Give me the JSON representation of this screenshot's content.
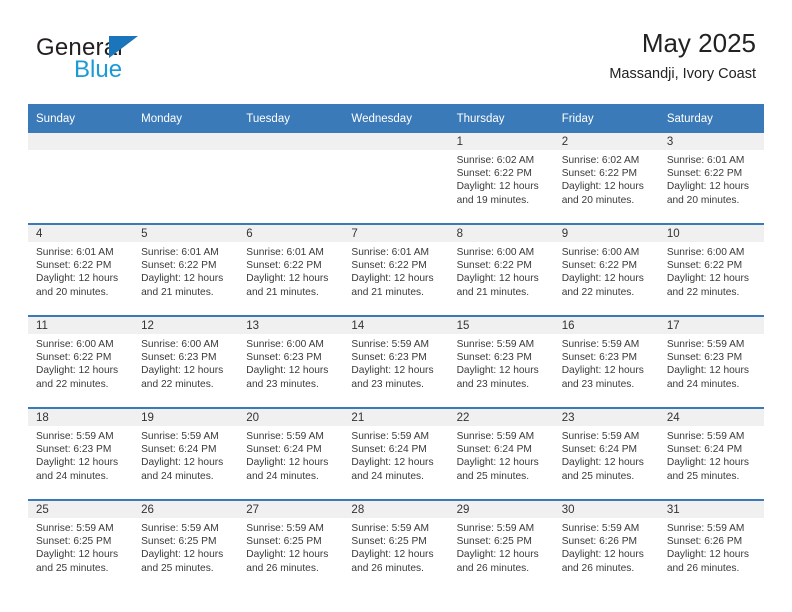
{
  "logo": {
    "word1": "General",
    "word2": "Blue",
    "triangle_color": "#1b75bb",
    "word2_color": "#1b9ad6"
  },
  "header": {
    "title": "May 2025",
    "subtitle": "Massandji, Ivory Coast"
  },
  "colors": {
    "header_blue": "#3b7ab8",
    "band_gray": "#f0f0f0",
    "text": "#222222"
  },
  "weekday_headers": [
    "Sunday",
    "Monday",
    "Tuesday",
    "Wednesday",
    "Thursday",
    "Friday",
    "Saturday"
  ],
  "labels": {
    "sunrise_prefix": "Sunrise:",
    "sunset_prefix": "Sunset:",
    "daylight_prefix": "Daylight:"
  },
  "weeks": [
    [
      {
        "day": "",
        "empty": true
      },
      {
        "day": "",
        "empty": true
      },
      {
        "day": "",
        "empty": true
      },
      {
        "day": "",
        "empty": true
      },
      {
        "day": "1",
        "sunrise": "Sunrise: 6:02 AM",
        "sunset": "Sunset: 6:22 PM",
        "daylight1": "Daylight: 12 hours",
        "daylight2": "and 19 minutes."
      },
      {
        "day": "2",
        "sunrise": "Sunrise: 6:02 AM",
        "sunset": "Sunset: 6:22 PM",
        "daylight1": "Daylight: 12 hours",
        "daylight2": "and 20 minutes."
      },
      {
        "day": "3",
        "sunrise": "Sunrise: 6:01 AM",
        "sunset": "Sunset: 6:22 PM",
        "daylight1": "Daylight: 12 hours",
        "daylight2": "and 20 minutes."
      }
    ],
    [
      {
        "day": "4",
        "sunrise": "Sunrise: 6:01 AM",
        "sunset": "Sunset: 6:22 PM",
        "daylight1": "Daylight: 12 hours",
        "daylight2": "and 20 minutes."
      },
      {
        "day": "5",
        "sunrise": "Sunrise: 6:01 AM",
        "sunset": "Sunset: 6:22 PM",
        "daylight1": "Daylight: 12 hours",
        "daylight2": "and 21 minutes."
      },
      {
        "day": "6",
        "sunrise": "Sunrise: 6:01 AM",
        "sunset": "Sunset: 6:22 PM",
        "daylight1": "Daylight: 12 hours",
        "daylight2": "and 21 minutes."
      },
      {
        "day": "7",
        "sunrise": "Sunrise: 6:01 AM",
        "sunset": "Sunset: 6:22 PM",
        "daylight1": "Daylight: 12 hours",
        "daylight2": "and 21 minutes."
      },
      {
        "day": "8",
        "sunrise": "Sunrise: 6:00 AM",
        "sunset": "Sunset: 6:22 PM",
        "daylight1": "Daylight: 12 hours",
        "daylight2": "and 21 minutes."
      },
      {
        "day": "9",
        "sunrise": "Sunrise: 6:00 AM",
        "sunset": "Sunset: 6:22 PM",
        "daylight1": "Daylight: 12 hours",
        "daylight2": "and 22 minutes."
      },
      {
        "day": "10",
        "sunrise": "Sunrise: 6:00 AM",
        "sunset": "Sunset: 6:22 PM",
        "daylight1": "Daylight: 12 hours",
        "daylight2": "and 22 minutes."
      }
    ],
    [
      {
        "day": "11",
        "sunrise": "Sunrise: 6:00 AM",
        "sunset": "Sunset: 6:22 PM",
        "daylight1": "Daylight: 12 hours",
        "daylight2": "and 22 minutes."
      },
      {
        "day": "12",
        "sunrise": "Sunrise: 6:00 AM",
        "sunset": "Sunset: 6:23 PM",
        "daylight1": "Daylight: 12 hours",
        "daylight2": "and 22 minutes."
      },
      {
        "day": "13",
        "sunrise": "Sunrise: 6:00 AM",
        "sunset": "Sunset: 6:23 PM",
        "daylight1": "Daylight: 12 hours",
        "daylight2": "and 23 minutes."
      },
      {
        "day": "14",
        "sunrise": "Sunrise: 5:59 AM",
        "sunset": "Sunset: 6:23 PM",
        "daylight1": "Daylight: 12 hours",
        "daylight2": "and 23 minutes."
      },
      {
        "day": "15",
        "sunrise": "Sunrise: 5:59 AM",
        "sunset": "Sunset: 6:23 PM",
        "daylight1": "Daylight: 12 hours",
        "daylight2": "and 23 minutes."
      },
      {
        "day": "16",
        "sunrise": "Sunrise: 5:59 AM",
        "sunset": "Sunset: 6:23 PM",
        "daylight1": "Daylight: 12 hours",
        "daylight2": "and 23 minutes."
      },
      {
        "day": "17",
        "sunrise": "Sunrise: 5:59 AM",
        "sunset": "Sunset: 6:23 PM",
        "daylight1": "Daylight: 12 hours",
        "daylight2": "and 24 minutes."
      }
    ],
    [
      {
        "day": "18",
        "sunrise": "Sunrise: 5:59 AM",
        "sunset": "Sunset: 6:23 PM",
        "daylight1": "Daylight: 12 hours",
        "daylight2": "and 24 minutes."
      },
      {
        "day": "19",
        "sunrise": "Sunrise: 5:59 AM",
        "sunset": "Sunset: 6:24 PM",
        "daylight1": "Daylight: 12 hours",
        "daylight2": "and 24 minutes."
      },
      {
        "day": "20",
        "sunrise": "Sunrise: 5:59 AM",
        "sunset": "Sunset: 6:24 PM",
        "daylight1": "Daylight: 12 hours",
        "daylight2": "and 24 minutes."
      },
      {
        "day": "21",
        "sunrise": "Sunrise: 5:59 AM",
        "sunset": "Sunset: 6:24 PM",
        "daylight1": "Daylight: 12 hours",
        "daylight2": "and 24 minutes."
      },
      {
        "day": "22",
        "sunrise": "Sunrise: 5:59 AM",
        "sunset": "Sunset: 6:24 PM",
        "daylight1": "Daylight: 12 hours",
        "daylight2": "and 25 minutes."
      },
      {
        "day": "23",
        "sunrise": "Sunrise: 5:59 AM",
        "sunset": "Sunset: 6:24 PM",
        "daylight1": "Daylight: 12 hours",
        "daylight2": "and 25 minutes."
      },
      {
        "day": "24",
        "sunrise": "Sunrise: 5:59 AM",
        "sunset": "Sunset: 6:24 PM",
        "daylight1": "Daylight: 12 hours",
        "daylight2": "and 25 minutes."
      }
    ],
    [
      {
        "day": "25",
        "sunrise": "Sunrise: 5:59 AM",
        "sunset": "Sunset: 6:25 PM",
        "daylight1": "Daylight: 12 hours",
        "daylight2": "and 25 minutes."
      },
      {
        "day": "26",
        "sunrise": "Sunrise: 5:59 AM",
        "sunset": "Sunset: 6:25 PM",
        "daylight1": "Daylight: 12 hours",
        "daylight2": "and 25 minutes."
      },
      {
        "day": "27",
        "sunrise": "Sunrise: 5:59 AM",
        "sunset": "Sunset: 6:25 PM",
        "daylight1": "Daylight: 12 hours",
        "daylight2": "and 26 minutes."
      },
      {
        "day": "28",
        "sunrise": "Sunrise: 5:59 AM",
        "sunset": "Sunset: 6:25 PM",
        "daylight1": "Daylight: 12 hours",
        "daylight2": "and 26 minutes."
      },
      {
        "day": "29",
        "sunrise": "Sunrise: 5:59 AM",
        "sunset": "Sunset: 6:25 PM",
        "daylight1": "Daylight: 12 hours",
        "daylight2": "and 26 minutes."
      },
      {
        "day": "30",
        "sunrise": "Sunrise: 5:59 AM",
        "sunset": "Sunset: 6:26 PM",
        "daylight1": "Daylight: 12 hours",
        "daylight2": "and 26 minutes."
      },
      {
        "day": "31",
        "sunrise": "Sunrise: 5:59 AM",
        "sunset": "Sunset: 6:26 PM",
        "daylight1": "Daylight: 12 hours",
        "daylight2": "and 26 minutes."
      }
    ]
  ]
}
